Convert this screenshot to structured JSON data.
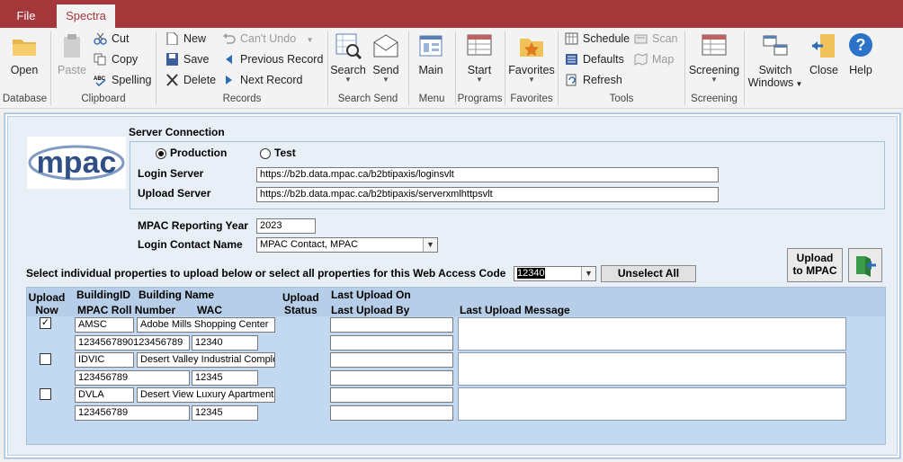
{
  "tabs": {
    "file": "File",
    "active": "Spectra"
  },
  "ribbon": {
    "open": "Open",
    "paste": "Paste",
    "cut": "Cut",
    "copy": "Copy",
    "spelling": "Spelling",
    "new": "New",
    "save": "Save",
    "delete": "Delete",
    "cant_undo": "Can't Undo",
    "previous_record": "Previous Record",
    "next_record": "Next Record",
    "search": "Search",
    "send": "Send",
    "main": "Main",
    "start": "Start",
    "favorites": "Favorites",
    "schedule": "Schedule",
    "defaults": "Defaults",
    "refresh": "Refresh",
    "scan": "Scan",
    "map": "Map",
    "screening": "Screening",
    "switch_windows_1": "Switch",
    "switch_windows_2": "Windows",
    "close": "Close",
    "help": "Help",
    "groups": {
      "database": "Database",
      "clipboard": "Clipboard",
      "records": "Records",
      "search_send": "Search Send",
      "menu": "Menu",
      "programs": "Programs",
      "favorites": "Favorites",
      "tools": "Tools",
      "screening": "Screening"
    }
  },
  "form": {
    "logo_text": "mpac",
    "server_connection": "Server Connection",
    "production": "Production",
    "test": "Test",
    "login_server_label": "Login Server",
    "login_server": "https://b2b.data.mpac.ca/b2btipaxis/loginsvlt",
    "upload_server_label": "Upload Server",
    "upload_server": "https://b2b.data.mpac.ca/b2btipaxis/serverxmlhttpsvlt",
    "reporting_year_label": "MPAC Reporting Year",
    "reporting_year": "2023",
    "contact_label": "Login Contact Name",
    "contact": "MPAC Contact, MPAC",
    "select_text": "Select individual properties to upload below or select all properties for this Web Access Code",
    "wac": "12340",
    "unselect_all": "Unselect All",
    "upload_1": "Upload",
    "upload_2": "to MPAC"
  },
  "grid": {
    "h_upload_now_1": "Upload",
    "h_upload_now_2": "Now",
    "h_building_id": "BuildingID",
    "h_building_name": "Building Name",
    "h_roll": "MPAC Roll Number",
    "h_wac": "WAC",
    "h_status_1": "Upload",
    "h_status_2": "Status",
    "h_last_on": "Last Upload On",
    "h_last_by": "Last Upload By",
    "h_message": "Last Upload Message",
    "rows": [
      {
        "id": "AMSC",
        "name": "Adobe Mills Shopping Center",
        "roll": "1234567890123456789",
        "wac": "12340",
        "checked": "✓"
      },
      {
        "id": "IDVIC",
        "name": "Desert Valley Industrial Complex",
        "roll": "123456789",
        "wac": "12345",
        "checked": ""
      },
      {
        "id": "DVLA",
        "name": "Desert View Luxury Apartments",
        "roll": "123456789",
        "wac": "12345",
        "checked": ""
      }
    ]
  }
}
